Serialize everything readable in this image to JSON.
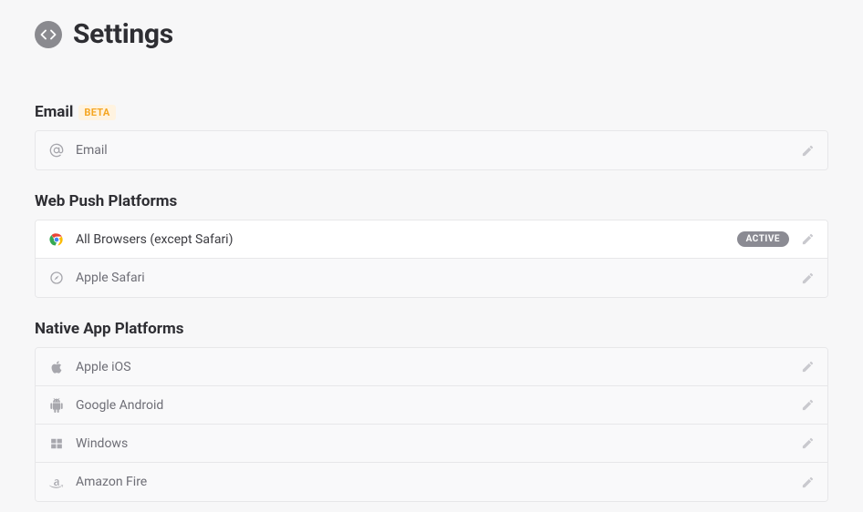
{
  "header": {
    "title": "Settings"
  },
  "sections": {
    "email": {
      "title": "Email",
      "badge": "BETA",
      "items": [
        {
          "label": "Email",
          "icon": "at-icon"
        }
      ]
    },
    "webpush": {
      "title": "Web Push Platforms",
      "items": [
        {
          "label": "All Browsers (except Safari)",
          "icon": "chrome-icon",
          "status": "ACTIVE",
          "active": true
        },
        {
          "label": "Apple Safari",
          "icon": "safari-icon"
        }
      ]
    },
    "native": {
      "title": "Native App Platforms",
      "items": [
        {
          "label": "Apple iOS",
          "icon": "apple-icon"
        },
        {
          "label": "Google Android",
          "icon": "android-icon"
        },
        {
          "label": "Windows",
          "icon": "windows-icon"
        },
        {
          "label": "Amazon Fire",
          "icon": "amazon-icon"
        }
      ]
    }
  }
}
